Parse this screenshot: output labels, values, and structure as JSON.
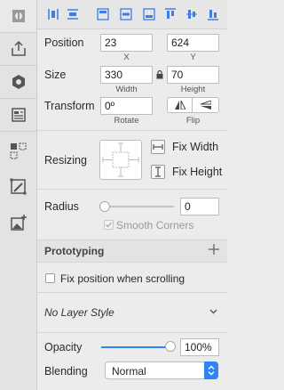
{
  "position": {
    "label": "Position",
    "x": "23",
    "y": "624",
    "x_caption": "X",
    "y_caption": "Y"
  },
  "size": {
    "label": "Size",
    "width": "330",
    "height": "70",
    "width_caption": "Width",
    "height_caption": "Height"
  },
  "transform": {
    "label": "Transform",
    "rotate": "0º",
    "rotate_caption": "Rotate",
    "flip_caption": "Flip"
  },
  "resizing": {
    "label": "Resizing",
    "fix_width": "Fix Width",
    "fix_height": "Fix Height"
  },
  "radius": {
    "label": "Radius",
    "value": "0",
    "smooth_corners": "Smooth Corners",
    "slider_value_pct": 0
  },
  "prototyping": {
    "title": "Prototyping",
    "add_icon": "plus-icon",
    "fix_position": "Fix position when scrolling"
  },
  "layer_style": {
    "value": "No Layer Style"
  },
  "opacity": {
    "label": "Opacity",
    "value": "100%",
    "slider_value_pct": 100
  },
  "blending": {
    "label": "Blending",
    "value": "Normal"
  },
  "colors": {
    "accent": "#2f83f6"
  }
}
